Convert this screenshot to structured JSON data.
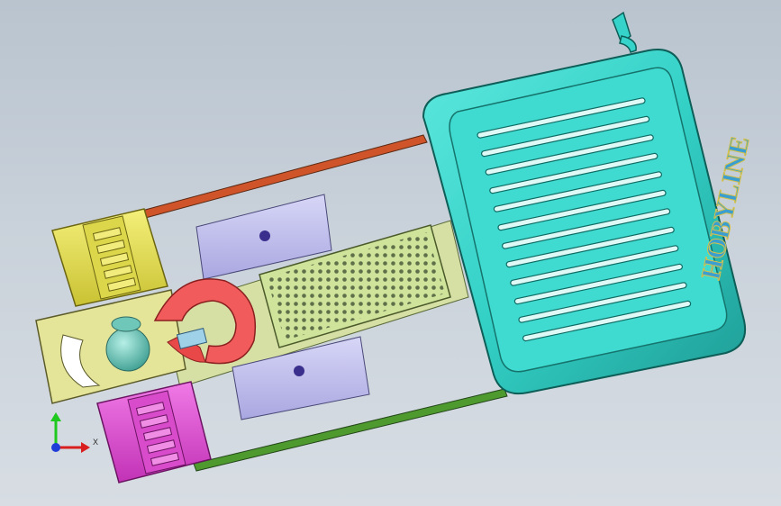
{
  "viewport": {
    "background_top": "#b9c4cf",
    "background_bottom": "#d7dde3"
  },
  "model": {
    "logo_text": "HOBYLINE",
    "colors": {
      "housing": "#35d3c9",
      "housing_dark": "#1f9f98",
      "yellow_roller": "#e6e04a",
      "magenta_roller": "#e34ad6",
      "frame": "#e5e59a",
      "clamp_blocks": "#c4c3f0",
      "perforated_plate": "#cfe39b",
      "gripper": "#f25b5b",
      "ball": "#67c2b5",
      "belt_top": "#d0542a",
      "belt_bottom": "#4e9a2e"
    }
  },
  "triad": {
    "x_label": "X",
    "x_color": "#d81e1e",
    "y_color": "#1ec81e",
    "z_color": "#1e3cd8"
  }
}
